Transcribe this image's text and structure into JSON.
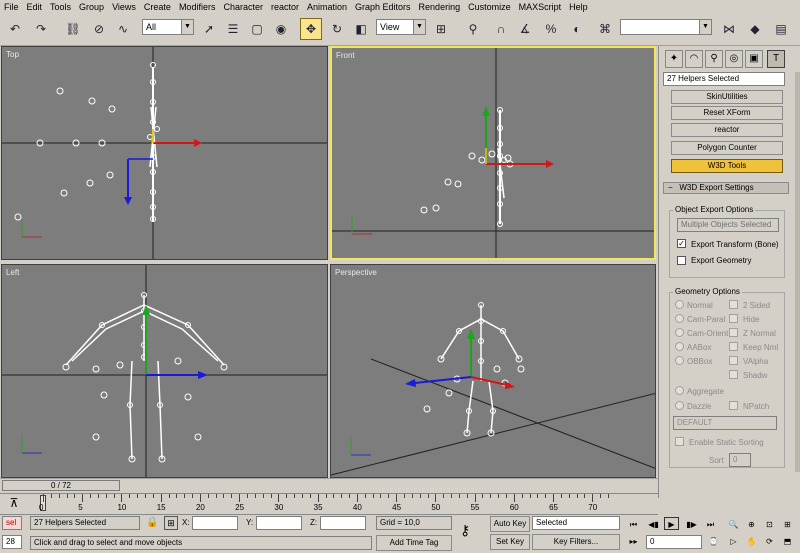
{
  "menu": [
    "File",
    "Edit",
    "Tools",
    "Group",
    "Views",
    "Create",
    "Modifiers",
    "Character",
    "reactor",
    "Animation",
    "Graph Editors",
    "Rendering",
    "Customize",
    "MAXScript",
    "Help"
  ],
  "toolbar": {
    "selection_filter": "All",
    "ref_coord": "View",
    "named_selection": ""
  },
  "viewports": {
    "top": "Top",
    "front": "Front",
    "left": "Left",
    "perspective": "Perspective"
  },
  "command_panel": {
    "selection_name": "27 Helpers Selected",
    "buttons": [
      "SkinUtilities",
      "Reset XForm",
      "reactor",
      "Polygon Counter",
      "W3D Tools"
    ],
    "rollout_title": "W3D Export Settings",
    "object_export": {
      "title": "Object Export Options",
      "multiple": "Multiple Objects Selected",
      "export_transform": "Export Transform (Bone)",
      "export_geometry": "Export Geometry",
      "export_transform_checked": true,
      "export_geometry_checked": false
    },
    "geometry": {
      "title": "Geometry Options",
      "left": [
        "Normal",
        "Cam-Paral",
        "Cam-Orient",
        "AABox",
        "OBBox"
      ],
      "right": [
        "2 Sided",
        "Hide",
        "Z Normal",
        "Keep Nml",
        "VAlpha",
        "Shadw"
      ],
      "aggregate": "Aggregate",
      "dazzle": "Dazzle",
      "npatch": "NPatch",
      "dropdown": "DEFAULT",
      "static_sort": "Enable Static Sorting",
      "sort_label": "Sort",
      "sort_value": "0"
    }
  },
  "timeline": {
    "slider": "0 / 72",
    "ticks": [
      "0",
      "5",
      "10",
      "15",
      "20",
      "25",
      "30",
      "35",
      "40",
      "45",
      "50",
      "55",
      "60",
      "65",
      "70"
    ]
  },
  "status": {
    "sel_label": "sel",
    "frame_field": "28",
    "selected_count": "27 Helpers Selected",
    "prompt": "Click and drag to select and move objects",
    "x_label": "X:",
    "y_label": "Y:",
    "z_label": "Z:",
    "x": "",
    "y": "",
    "z": "",
    "grid": "Grid = 10,0",
    "add_time_tag": "Add Time Tag",
    "auto_key": "Auto Key",
    "set_key": "Set Key",
    "key_mode": "Selected",
    "key_filters": "Key Filters...",
    "current_frame": "0"
  }
}
